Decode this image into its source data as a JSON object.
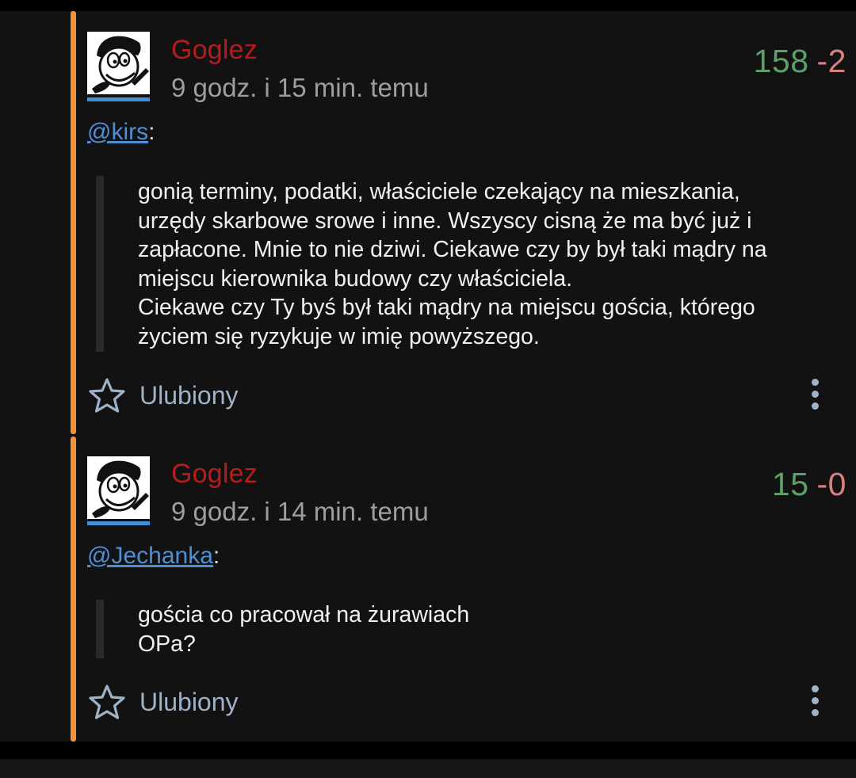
{
  "comments": [
    {
      "author": "Goglez",
      "time": "9 godz. i 15 min. temu",
      "votes_plus": "158",
      "votes_minus": "-2",
      "mention": "@kirs",
      "mention_suffix": ":",
      "quote_lines": [
        "gonią terminy, podatki, właściciele czekający na mieszkania,",
        "urzędy skarbowe srowe i inne. Wszyscy cisną że ma być już i",
        "zapłacone. Mnie to nie dziwi. Ciekawe czy by był taki mądry na",
        "miejscu kierownika budowy czy właściciela.",
        "Ciekawe czy Ty byś był taki mądry na miejscu gościa, którego",
        "życiem się ryzykuje w imię powyższego."
      ],
      "favorite_label": "Ulubiony"
    },
    {
      "author": "Goglez",
      "time": "9 godz. i 14 min. temu",
      "votes_plus": "15",
      "votes_minus": "-0",
      "mention": "@Jechanka",
      "mention_suffix": ":",
      "quote_lines": [
        "gościa co pracował na żurawiach",
        "OPa?"
      ],
      "favorite_label": "Ulubiony"
    }
  ],
  "icons": {
    "favorite": "star-outline-icon",
    "more": "more-vertical-icon",
    "avatar": "cartoon-face-avatar"
  },
  "colors": {
    "background": "#121212",
    "thread_line": "#f39237",
    "author": "#b71c1c",
    "plus": "#5f9f6a",
    "minus": "#d98080",
    "mention": "#4f8fd6",
    "avatar_underline": "#3f8fd9"
  }
}
